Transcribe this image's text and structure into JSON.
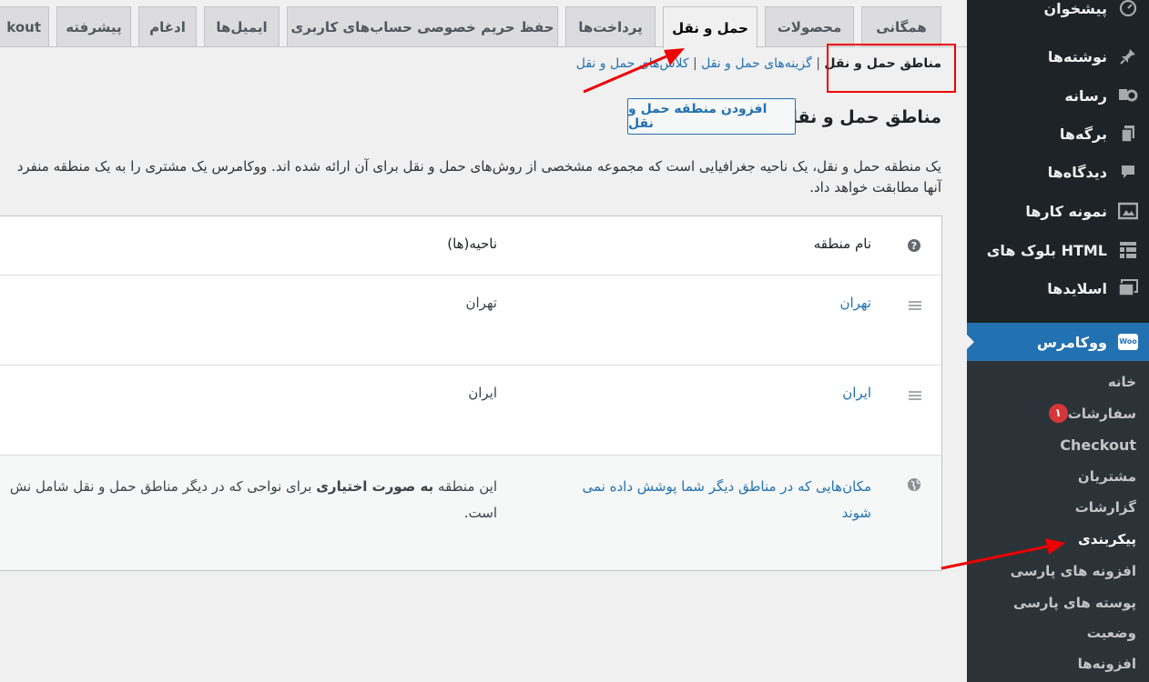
{
  "sidebar": {
    "items": [
      {
        "label": "پیشخوان",
        "icon": "dashboard-icon"
      },
      {
        "label": "نوشته‌ها",
        "icon": "pin-icon"
      },
      {
        "label": "رسانه",
        "icon": "media-icon"
      },
      {
        "label": "برگه‌ها",
        "icon": "pages-icon"
      },
      {
        "label": "دیدگاه‌ها",
        "icon": "comment-icon"
      },
      {
        "label": "نمونه کارها",
        "icon": "portfolio-icon"
      },
      {
        "label": "بلوک های HTML",
        "icon": "blocks-icon"
      },
      {
        "label": "اسلایدها",
        "icon": "slides-icon"
      }
    ],
    "woocommerce": {
      "label": "ووکامرس",
      "icon": "woo-icon",
      "icon_text": "Woo"
    },
    "submenu": [
      {
        "label": "خانه"
      },
      {
        "label": "سفارشات",
        "badge": "۱"
      },
      {
        "label": "Checkout"
      },
      {
        "label": "مشتریان"
      },
      {
        "label": "گزارشات"
      },
      {
        "label": "پیکربندی"
      },
      {
        "label": "افزونه های پارسی"
      },
      {
        "label": "پوسته های پارسی"
      },
      {
        "label": "وضعیت"
      },
      {
        "label": "افزونه‌ها"
      }
    ],
    "active_color": "#2271b1",
    "bg_color": "#1d2327"
  },
  "tabs": [
    {
      "label": "همگانی"
    },
    {
      "label": "محصولات"
    },
    {
      "label": "حمل و نقل",
      "active": true
    },
    {
      "label": "پرداخت‌ها"
    },
    {
      "label": "حفظ حریم خصوصی حساب‌های کاربری"
    },
    {
      "label": "ایمیل‌ها"
    },
    {
      "label": "ادغام"
    },
    {
      "label": "پیشرفته"
    },
    {
      "label": "kout"
    }
  ],
  "breadcrumb": {
    "current": "مناطق حمل و نقل",
    "sep": "|",
    "links": [
      "گزینه‌های حمل و نقل",
      "کلاس‌های حمل و نقل"
    ]
  },
  "page": {
    "title": "مناطق حمل و نقل",
    "add_button": "افزودن منطقه حمل و نقل",
    "description_line1": "یک منطقه حمل و نقل، یک ناحیه جغرافیایی است که مجموعه مشخصی از روش‌های حمل و نقل برای آن ارائه شده اند. ووکامرس یک مشتری را به یک منطقه منفرد",
    "description_line2": "آنها مطابقت خواهد داد."
  },
  "table": {
    "col_zone_name": "نام منطقه",
    "col_regions": "ناحیه(ها)",
    "rows": [
      {
        "name": "تهران",
        "region": "تهران"
      },
      {
        "name": "ایران",
        "region": "ایران"
      }
    ],
    "rest": {
      "name_line1": "مکان‌هایی که در مناطق دیگر شما پوشش داده نمی",
      "name_line2": "شوند",
      "desc_prefix": "این منطقه",
      "desc_bold": "به صورت اختیاری",
      "desc_suffix": "برای نواحی که در دیگر مناطق حمل و نقل شامل نش",
      "desc_line2": "است."
    }
  }
}
